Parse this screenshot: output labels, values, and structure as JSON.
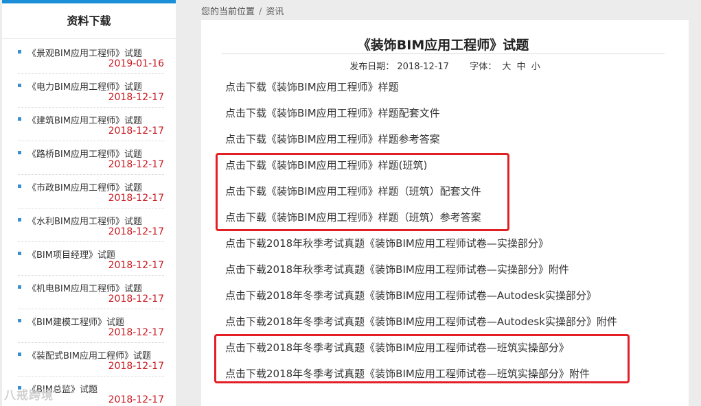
{
  "sidebar": {
    "title": "资料下载",
    "items": [
      {
        "name": "《景观BIM应用工程师》试题",
        "date": "2019-01-16"
      },
      {
        "name": "《电力BIM应用工程师》试题",
        "date": "2018-12-17"
      },
      {
        "name": "《建筑BIM应用工程师》试题",
        "date": "2018-12-17"
      },
      {
        "name": "《路桥BIM应用工程师》试题",
        "date": "2018-12-17"
      },
      {
        "name": "《市政BIM应用工程师》试题",
        "date": "2018-12-17"
      },
      {
        "name": "《水利BIM应用工程师》试题",
        "date": "2018-12-17"
      },
      {
        "name": "《BIM项目经理》试题",
        "date": "2018-12-17"
      },
      {
        "name": "《机电BIM应用工程师》试题",
        "date": "2018-12-17"
      },
      {
        "name": "《BIM建模工程师》试题",
        "date": "2018-12-17"
      },
      {
        "name": "《装配式BIM应用工程师》试题",
        "date": "2018-12-17"
      },
      {
        "name": "《BIM总监》试题",
        "date": "2018-12-17"
      }
    ]
  },
  "breadcrumb": {
    "location": "您的当前位置",
    "separator": "/",
    "current": "资讯"
  },
  "article": {
    "title": "《装饰BIM应用工程师》试题",
    "date_label": "发布日期：",
    "date": "2018-12-17",
    "font_label": "字体：",
    "font_large": "大",
    "font_medium": "中",
    "font_small": "小",
    "links": [
      "点击下载《装饰BIM应用工程师》样题",
      "点击下载《装饰BIM应用工程师》样题配套文件",
      "点击下载《装饰BIM应用工程师》样题参考答案",
      "点击下载《装饰BIM应用工程师》样题(班筑)",
      "点击下载《装饰BIM应用工程师》样题（班筑）配套文件",
      "点击下载《装饰BIM应用工程师》样题（班筑）参考答案",
      "点击下载2018年秋季考试真题《装饰BIM应用工程师试卷—实操部分》",
      "点击下载2018年秋季考试真题《装饰BIM应用工程师试卷—实操部分》附件",
      "点击下载2018年冬季考试真题《装饰BIM应用工程师试卷—Autodesk实操部分》",
      "点击下载2018年冬季考试真题《装饰BIM应用工程师试卷—Autodesk实操部分》附件",
      "点击下载2018年冬季考试真题《装饰BIM应用工程师试卷—班筑实操部分》",
      "点击下载2018年冬季考试真题《装饰BIM应用工程师试卷—班筑实操部分》附件"
    ]
  },
  "watermark": "八戒跨境",
  "colors": {
    "accent": "#1a8fd8",
    "date_red": "#c8171e",
    "highlight_red": "#e31e24"
  }
}
